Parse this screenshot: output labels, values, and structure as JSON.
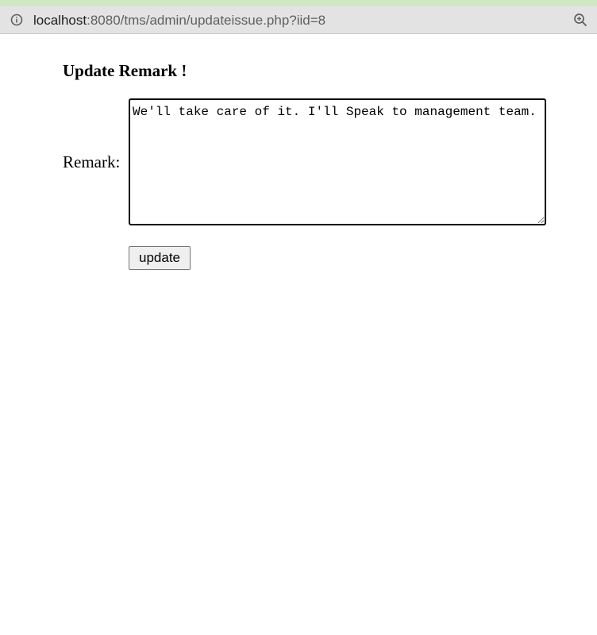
{
  "browser": {
    "url_host": "localhost",
    "url_rest": ":8080/tms/admin/updateissue.php?iid=8",
    "info_icon": "info-icon",
    "zoom_icon": "zoom-in-icon"
  },
  "form": {
    "heading": "Update Remark !",
    "remark_label": "Remark:",
    "remark_value": "We'll take care of it. I'll Speak to management team.",
    "update_label": "update"
  }
}
